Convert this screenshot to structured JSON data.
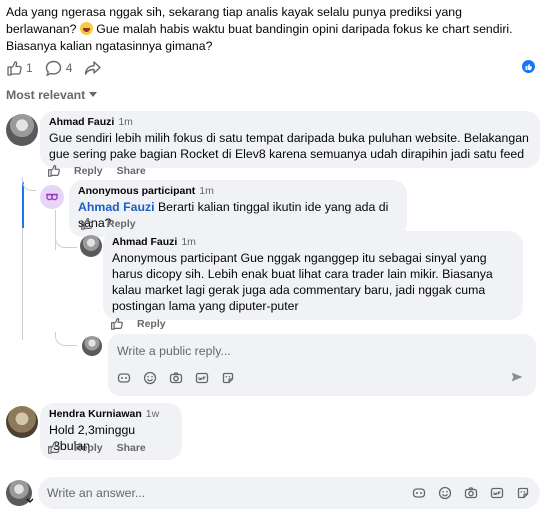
{
  "post": {
    "text": "Ada yang ngerasa nggak sih, sekarang tiap analis kayak selalu punya prediksi yang berlawanan?",
    "text2": "Gue malah habis waktu buat bandingin opini daripada fokus ke chart sendiri. Biasanya kalian ngatasinnya gimana?",
    "like_count": "1",
    "comment_count": "4"
  },
  "sort_label": "Most relevant",
  "comments": [
    {
      "author": "Ahmad Fauzi",
      "time": "1m",
      "text": "Gue sendiri lebih milih fokus di satu tempat daripada buka puluhan website. Belakangan gue sering pake bagian Rocket di Elev8 karena semuanya udah dirapihin jadi satu feed",
      "reply_label": "Reply",
      "share_label": "Share"
    },
    {
      "author": "Anonymous participant",
      "time": "1m",
      "mention": "Ahmad Fauzi",
      "text": "Berarti kalian tinggal ikutin ide yang ada di sana?",
      "reply_label": "Reply"
    },
    {
      "author": "Ahmad Fauzi",
      "time": "1m",
      "text": "Anonymous participant Gue nggak nganggep itu sebagai sinyal yang harus dicopy sih. Lebih enak buat lihat cara trader lain mikir. Biasanya kalau market lagi gerak juga ada commentary baru, jadi nggak cuma postingan lama yang diputer-puter",
      "reply_label": "Reply"
    },
    {
      "author": "Hendra Kurniawan",
      "time": "1w",
      "text": "Hold 2,3minggu -3bulan",
      "reply_label": "Reply",
      "share_label": "Share"
    }
  ],
  "reply_placeholder": "Write a public reply...",
  "answer_placeholder": "Write an answer...",
  "colors": {
    "accent": "#1877f2",
    "mention": "#1b5fc5",
    "muted": "#65676b",
    "bubble": "#f0f2f5"
  }
}
